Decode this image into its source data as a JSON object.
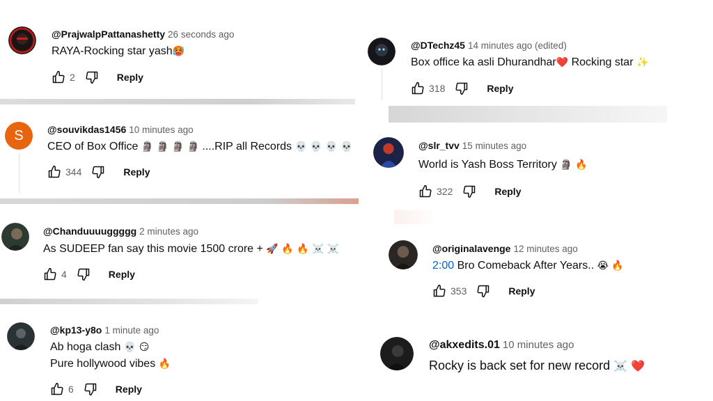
{
  "comments": [
    {
      "handle": "@PrajwalpPattanashetty",
      "time": "26 seconds ago",
      "text": "RAYA-Rocking star yash",
      "emoji": "🥵",
      "likes": "2",
      "reply": "Reply"
    },
    {
      "handle": "@souvikdas1456",
      "time": "10 minutes ago",
      "avatar_letter": "S",
      "text": "CEO of Box Office ",
      "emoji1": "🗿 🗿 🗿 🗿",
      "text2": " ....RIP all Records ",
      "emoji2": "💀 💀 💀 💀",
      "likes": "344",
      "reply": "Reply"
    },
    {
      "handle": "@Chanduuuuggggg",
      "time": "2 minutes ago",
      "text": "As SUDEEP fan say  this movie 1500 crore + ",
      "emoji": "🚀 🔥 🔥 ☠️ ☠️",
      "likes": "4",
      "reply": "Reply"
    },
    {
      "handle": "@kp13-y8o",
      "time": "1 minute ago",
      "text": "Ab hoga clash ",
      "emoji": "💀 😏",
      "text2": "Pure hollywood vibes ",
      "emoji2": "🔥",
      "likes": "6",
      "reply": "Reply"
    },
    {
      "handle": "@DTechz45",
      "time": "14 minutes ago (edited)",
      "text": "Box office ka asli Dhurandhar",
      "emoji": "❤️",
      "text2": " Rocking star ",
      "emoji2": "✨",
      "likes": "318",
      "reply": "Reply"
    },
    {
      "handle": "@slr_tvv",
      "time": "15 minutes ago",
      "text": "World is Yash Boss Territory ",
      "emoji": "🗿 🔥",
      "likes": "322",
      "reply": "Reply"
    },
    {
      "handle": "@originalavenge",
      "time": "12 minutes ago",
      "timestamp": "2:00",
      "text": " Bro Comeback After Years.. ",
      "emoji": "😭 🔥",
      "likes": "353",
      "reply": "Reply"
    },
    {
      "handle": "@akxedits.01",
      "time": "10 minutes ago",
      "text": "Rocky is back set for new record ",
      "emoji": "☠️ ❤️"
    }
  ],
  "icons": {
    "like": "thumbs-up-icon",
    "dislike": "thumbs-down-icon"
  },
  "colors": {
    "avatar_s": "#e8650f",
    "timestamp_link": "#065fd4",
    "handle": "#0f0f0f",
    "meta": "#606060"
  }
}
